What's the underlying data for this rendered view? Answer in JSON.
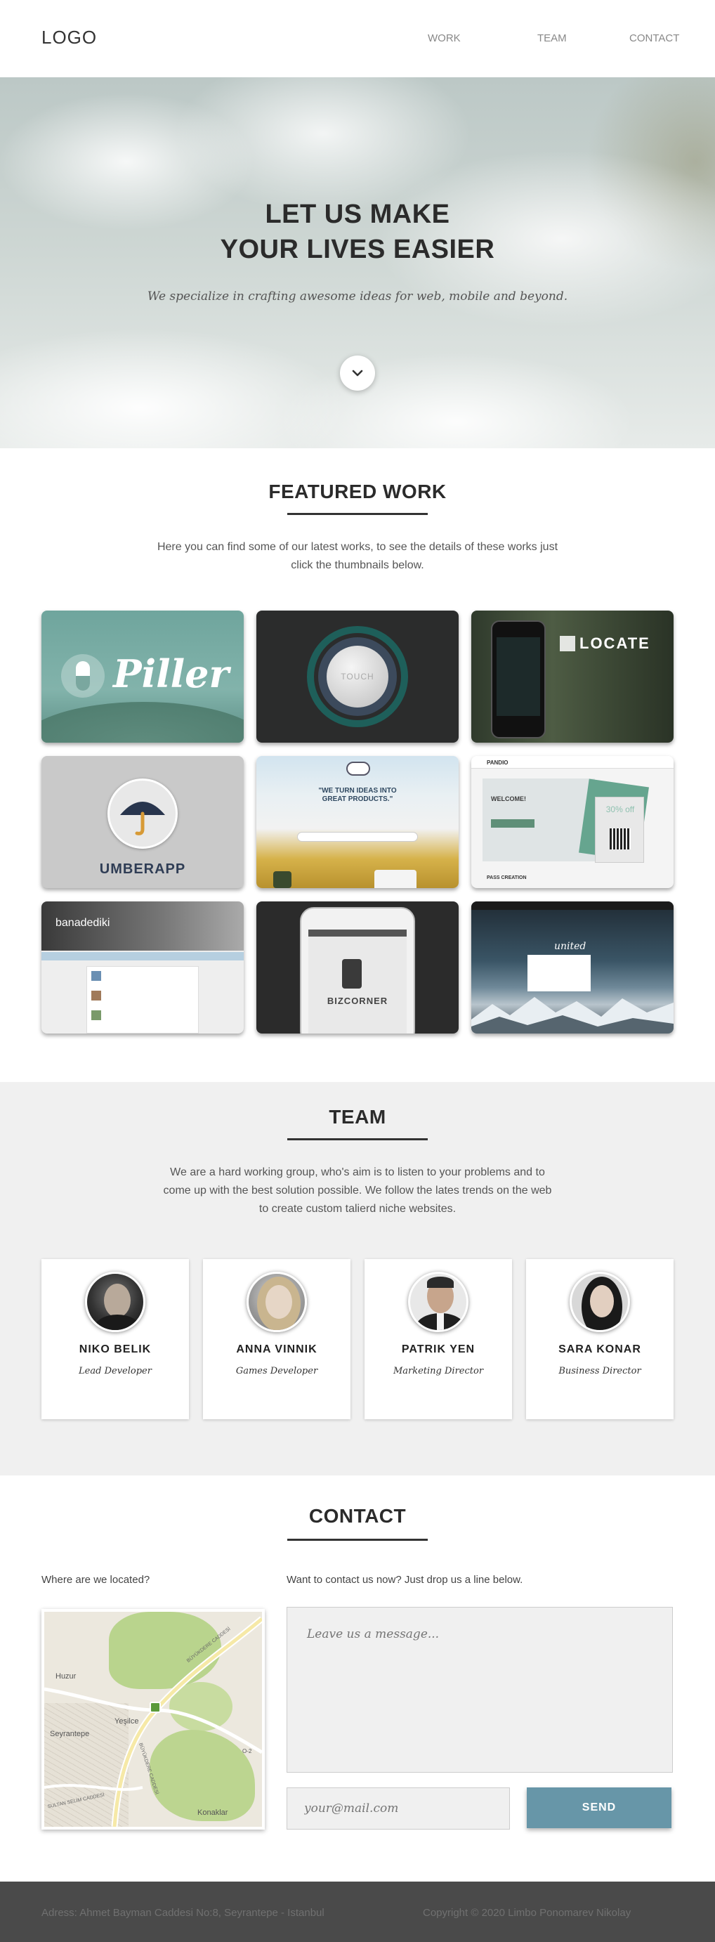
{
  "header": {
    "logo": "LOGO",
    "nav": [
      "WORK",
      "TEAM",
      "CONTACT"
    ]
  },
  "hero": {
    "title_line1": "LET US MAKE",
    "title_line2": "YOUR LIVES EASIER",
    "subtitle": "We specialize in crafting awesome ideas for web, mobile and beyond."
  },
  "work": {
    "title": "FEATURED WORK",
    "description": "Here you can find some of our latest works, to see the details of these works just click the thumbnails below.",
    "thumbs": {
      "piller": "Piller",
      "touch": "TOUCH",
      "locate": "LOCATE",
      "umberapp": "UMBERAPP",
      "ideas": "\"WE TURN IDEAS INTO GREAT PRODUCTS.\"",
      "pandio_logo": "PANDIO",
      "pandio_welcome": "WELCOME!",
      "pandio_sale": "30% off",
      "pandio_page": "PASS CREATION",
      "banade": "banadediki",
      "bizcorner": "BIZCORNER",
      "united": "united"
    }
  },
  "team": {
    "title": "TEAM",
    "description": "We are a hard working group, who's aim is to listen to your problems and to come up with the best solution possible. We follow the lates trends on the web to create custom talierd niche websites.",
    "members": [
      {
        "name": "NIKO BELIK",
        "role": "Lead Developer"
      },
      {
        "name": "ANNA VINNIK",
        "role": "Games Developer"
      },
      {
        "name": "PATRIK YEN",
        "role": "Marketing Director"
      },
      {
        "name": "SARA KONAR",
        "role": "Business Director"
      }
    ]
  },
  "contact": {
    "title": "CONTACT",
    "location_label": "Where are we located?",
    "message_label": "Want to contact us now? Just drop us a line below.",
    "message_placeholder": "Leave us a message...",
    "email_placeholder": "your@mail.com",
    "send_label": "SEND",
    "map_labels": {
      "huzur": "Huzur",
      "yesilce": "Yeşilce",
      "seyrantepe": "Seyrantepe",
      "konaklar": "Konaklar",
      "o2": "O-2",
      "street1": "BÜYÜKDERE CADDESİ",
      "street2": "BÜYÜKDERE CADDESİ",
      "street3": "SULTAN SELİM CADDESİ"
    }
  },
  "footer": {
    "address": "Adress: Ahmet Bayman Caddesi No:8, Seyrantepe - Istanbul",
    "copyright": "Copyright © 2020 Limbo Ponomarev Nikolay"
  }
}
